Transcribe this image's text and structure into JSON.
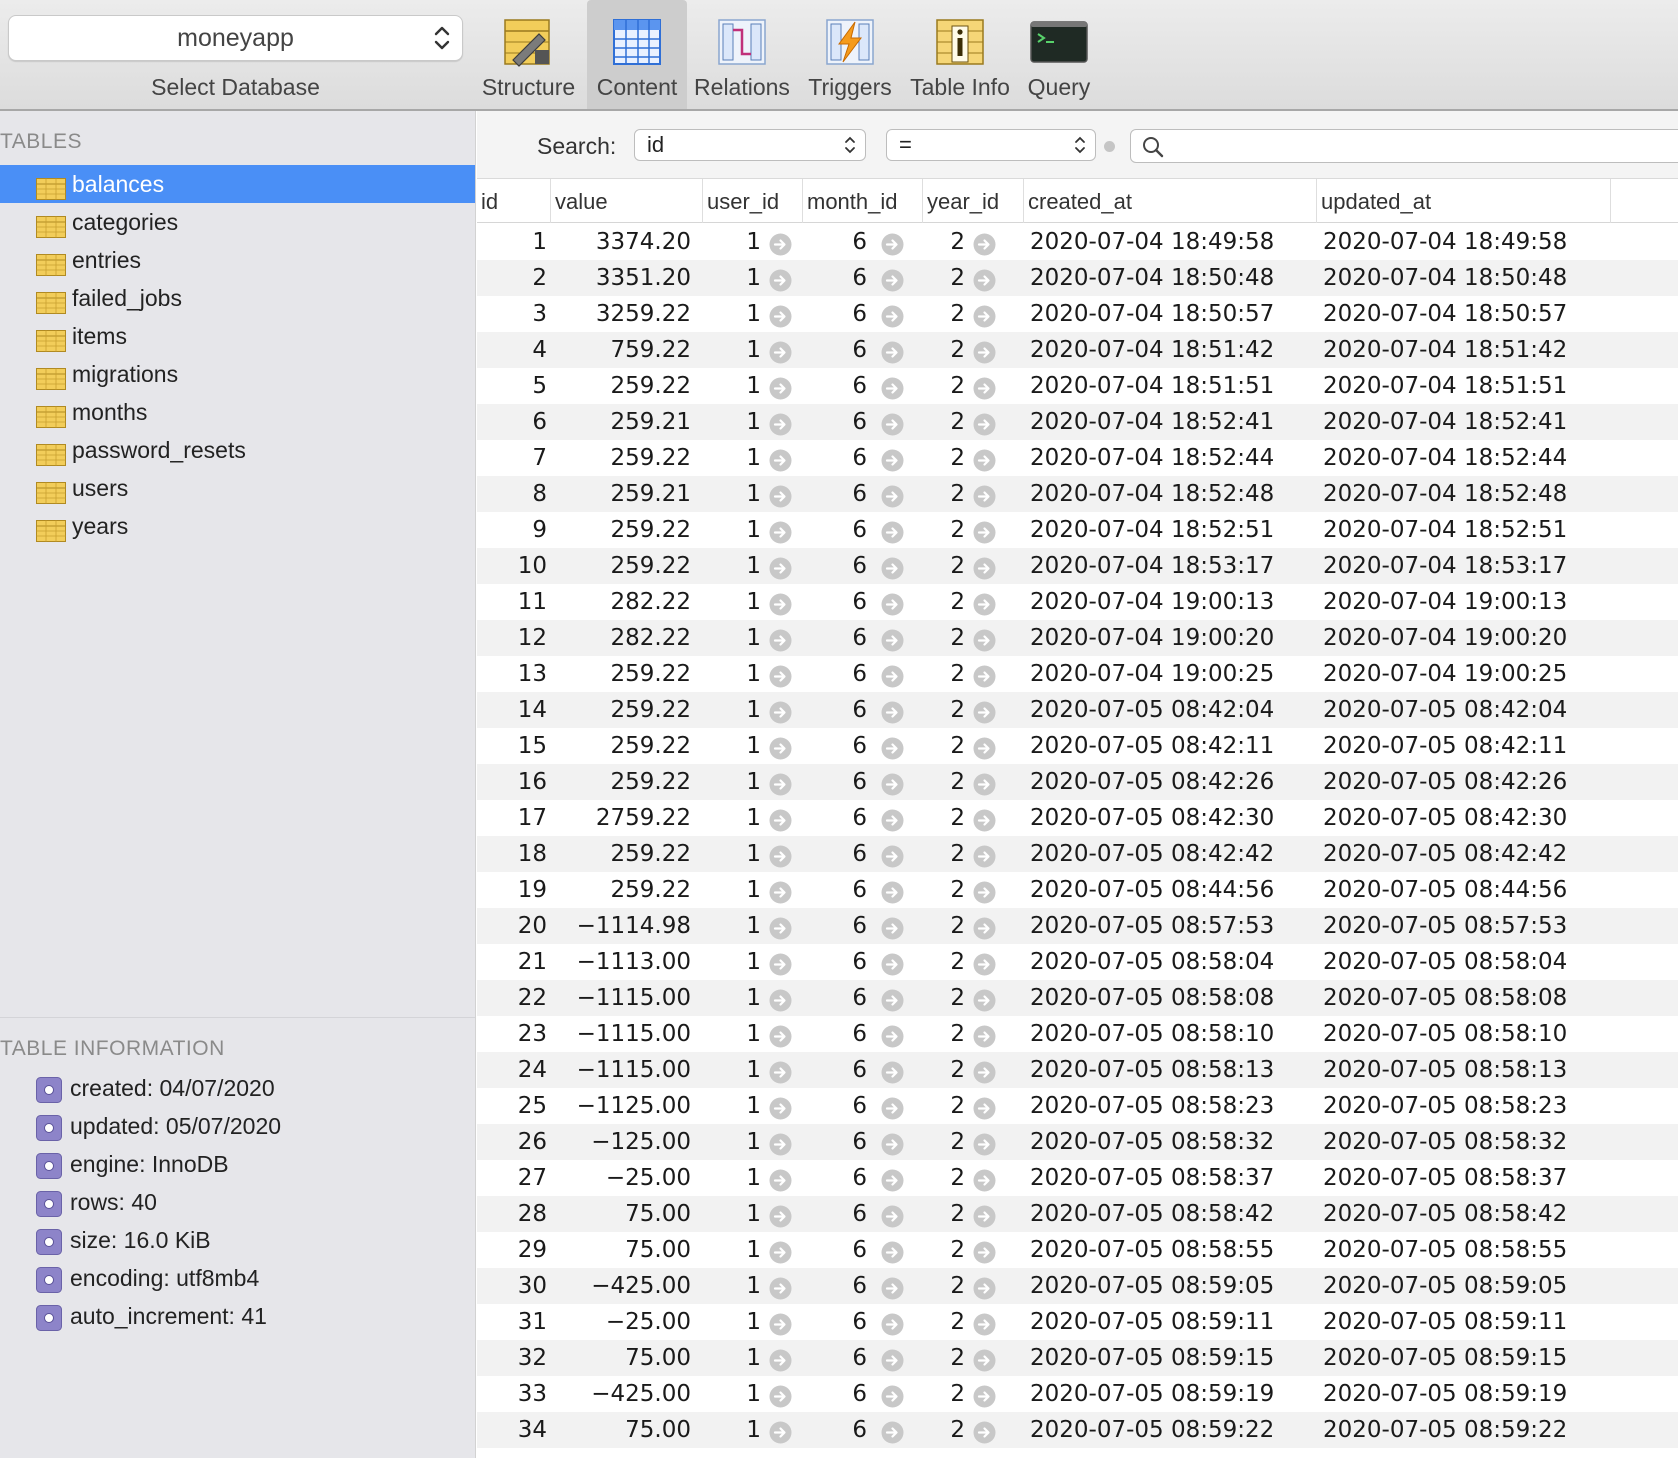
{
  "toolbar": {
    "database": "moneyapp",
    "database_caption": "Select Database",
    "buttons": [
      {
        "label": "Structure",
        "icon": "structure-icon"
      },
      {
        "label": "Content",
        "icon": "content-icon",
        "active": true
      },
      {
        "label": "Relations",
        "icon": "relations-icon"
      },
      {
        "label": "Triggers",
        "icon": "triggers-icon"
      },
      {
        "label": "Table Info",
        "icon": "table-info-icon"
      },
      {
        "label": "Query",
        "icon": "query-icon"
      }
    ]
  },
  "sidebar": {
    "tables_heading": "TABLES",
    "tables": [
      "balances",
      "categories",
      "entries",
      "failed_jobs",
      "items",
      "migrations",
      "months",
      "password_resets",
      "users",
      "years"
    ],
    "selected_table": "balances",
    "info_heading": "TABLE INFORMATION",
    "info": [
      "created: 04/07/2020",
      "updated: 05/07/2020",
      "engine: InnoDB",
      "rows: 40",
      "size: 16.0 KiB",
      "encoding: utf8mb4",
      "auto_increment: 41"
    ]
  },
  "search": {
    "label": "Search:",
    "field": "id",
    "operator": "=",
    "query": ""
  },
  "colors": {
    "selection": "#4a8ff6",
    "sidebar_bg": "#e6e6ea",
    "row_alt": "#f2f2f2",
    "table_icon": "#f0c850"
  },
  "grid": {
    "columns": [
      "id",
      "value",
      "user_id",
      "month_id",
      "year_id",
      "created_at",
      "updated_at"
    ],
    "rows": [
      [
        "1",
        "3374.20",
        "1",
        "6",
        "2",
        "2020-07-04 18:49:58",
        "2020-07-04 18:49:58"
      ],
      [
        "2",
        "3351.20",
        "1",
        "6",
        "2",
        "2020-07-04 18:50:48",
        "2020-07-04 18:50:48"
      ],
      [
        "3",
        "3259.22",
        "1",
        "6",
        "2",
        "2020-07-04 18:50:57",
        "2020-07-04 18:50:57"
      ],
      [
        "4",
        "759.22",
        "1",
        "6",
        "2",
        "2020-07-04 18:51:42",
        "2020-07-04 18:51:42"
      ],
      [
        "5",
        "259.22",
        "1",
        "6",
        "2",
        "2020-07-04 18:51:51",
        "2020-07-04 18:51:51"
      ],
      [
        "6",
        "259.21",
        "1",
        "6",
        "2",
        "2020-07-04 18:52:41",
        "2020-07-04 18:52:41"
      ],
      [
        "7",
        "259.22",
        "1",
        "6",
        "2",
        "2020-07-04 18:52:44",
        "2020-07-04 18:52:44"
      ],
      [
        "8",
        "259.21",
        "1",
        "6",
        "2",
        "2020-07-04 18:52:48",
        "2020-07-04 18:52:48"
      ],
      [
        "9",
        "259.22",
        "1",
        "6",
        "2",
        "2020-07-04 18:52:51",
        "2020-07-04 18:52:51"
      ],
      [
        "10",
        "259.22",
        "1",
        "6",
        "2",
        "2020-07-04 18:53:17",
        "2020-07-04 18:53:17"
      ],
      [
        "11",
        "282.22",
        "1",
        "6",
        "2",
        "2020-07-04 19:00:13",
        "2020-07-04 19:00:13"
      ],
      [
        "12",
        "282.22",
        "1",
        "6",
        "2",
        "2020-07-04 19:00:20",
        "2020-07-04 19:00:20"
      ],
      [
        "13",
        "259.22",
        "1",
        "6",
        "2",
        "2020-07-04 19:00:25",
        "2020-07-04 19:00:25"
      ],
      [
        "14",
        "259.22",
        "1",
        "6",
        "2",
        "2020-07-05 08:42:04",
        "2020-07-05 08:42:04"
      ],
      [
        "15",
        "259.22",
        "1",
        "6",
        "2",
        "2020-07-05 08:42:11",
        "2020-07-05 08:42:11"
      ],
      [
        "16",
        "259.22",
        "1",
        "6",
        "2",
        "2020-07-05 08:42:26",
        "2020-07-05 08:42:26"
      ],
      [
        "17",
        "2759.22",
        "1",
        "6",
        "2",
        "2020-07-05 08:42:30",
        "2020-07-05 08:42:30"
      ],
      [
        "18",
        "259.22",
        "1",
        "6",
        "2",
        "2020-07-05 08:42:42",
        "2020-07-05 08:42:42"
      ],
      [
        "19",
        "259.22",
        "1",
        "6",
        "2",
        "2020-07-05 08:44:56",
        "2020-07-05 08:44:56"
      ],
      [
        "20",
        "−1114.98",
        "1",
        "6",
        "2",
        "2020-07-05 08:57:53",
        "2020-07-05 08:57:53"
      ],
      [
        "21",
        "−1113.00",
        "1",
        "6",
        "2",
        "2020-07-05 08:58:04",
        "2020-07-05 08:58:04"
      ],
      [
        "22",
        "−1115.00",
        "1",
        "6",
        "2",
        "2020-07-05 08:58:08",
        "2020-07-05 08:58:08"
      ],
      [
        "23",
        "−1115.00",
        "1",
        "6",
        "2",
        "2020-07-05 08:58:10",
        "2020-07-05 08:58:10"
      ],
      [
        "24",
        "−1115.00",
        "1",
        "6",
        "2",
        "2020-07-05 08:58:13",
        "2020-07-05 08:58:13"
      ],
      [
        "25",
        "−1125.00",
        "1",
        "6",
        "2",
        "2020-07-05 08:58:23",
        "2020-07-05 08:58:23"
      ],
      [
        "26",
        "−125.00",
        "1",
        "6",
        "2",
        "2020-07-05 08:58:32",
        "2020-07-05 08:58:32"
      ],
      [
        "27",
        "−25.00",
        "1",
        "6",
        "2",
        "2020-07-05 08:58:37",
        "2020-07-05 08:58:37"
      ],
      [
        "28",
        "75.00",
        "1",
        "6",
        "2",
        "2020-07-05 08:58:42",
        "2020-07-05 08:58:42"
      ],
      [
        "29",
        "75.00",
        "1",
        "6",
        "2",
        "2020-07-05 08:58:55",
        "2020-07-05 08:58:55"
      ],
      [
        "30",
        "−425.00",
        "1",
        "6",
        "2",
        "2020-07-05 08:59:05",
        "2020-07-05 08:59:05"
      ],
      [
        "31",
        "−25.00",
        "1",
        "6",
        "2",
        "2020-07-05 08:59:11",
        "2020-07-05 08:59:11"
      ],
      [
        "32",
        "75.00",
        "1",
        "6",
        "2",
        "2020-07-05 08:59:15",
        "2020-07-05 08:59:15"
      ],
      [
        "33",
        "−425.00",
        "1",
        "6",
        "2",
        "2020-07-05 08:59:19",
        "2020-07-05 08:59:19"
      ],
      [
        "34",
        "75.00",
        "1",
        "6",
        "2",
        "2020-07-05 08:59:22",
        "2020-07-05 08:59:22"
      ]
    ]
  }
}
